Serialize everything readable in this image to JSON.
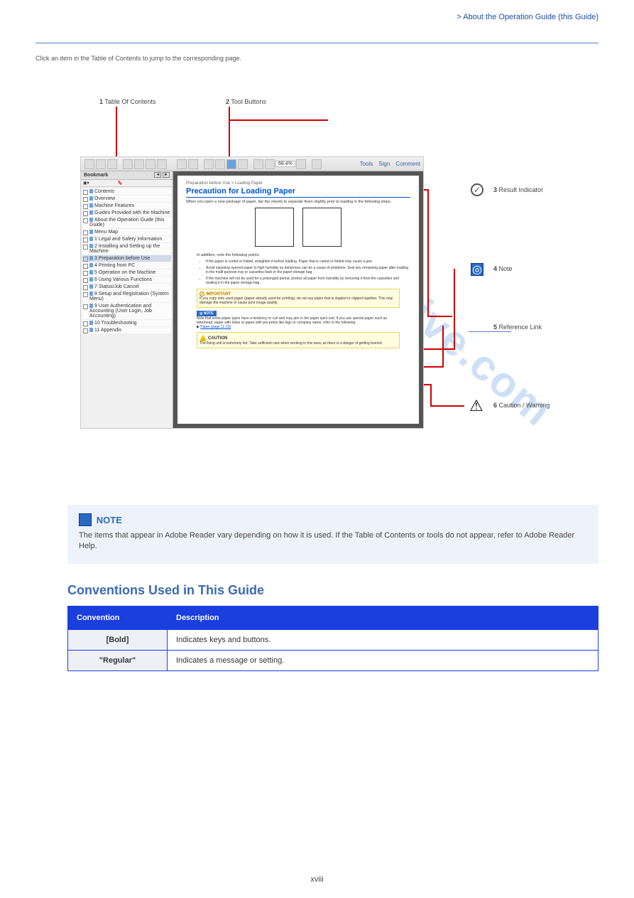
{
  "header": {
    "right": "> About the Operation Guide (this Guide)"
  },
  "intro": "Click an item in the Table of Contents to jump to the corresponding page.",
  "callouts": {
    "c1": {
      "num": "1",
      "text": "Table Of Contents"
    },
    "c2": {
      "num": "2",
      "text": "Tool Buttons"
    },
    "c3": {
      "num": "3",
      "text": "Result Indicator"
    },
    "c4": {
      "num": "4",
      "text": "Note"
    },
    "c5": {
      "num": "5",
      "text": "Reference Link"
    },
    "c6": {
      "num": "6",
      "text": "Caution / Warning"
    }
  },
  "screenshot": {
    "toolbar": {
      "zoom": "68.4%",
      "right": [
        "Tools",
        "Sign",
        "Comment"
      ]
    },
    "sidebar": {
      "tab": "Bookmark",
      "buttons": [
        "◄",
        "►"
      ],
      "items": [
        {
          "label": "Contents",
          "sel": false
        },
        {
          "label": "Overview",
          "sel": false
        },
        {
          "label": "Machine Features",
          "sel": false
        },
        {
          "label": "Guides Provided with the Machine",
          "sel": false
        },
        {
          "label": "About the Operation Guide (this Guide)",
          "sel": false
        },
        {
          "label": "Menu Map",
          "sel": false
        },
        {
          "label": "1 Legal and Safety Information",
          "sel": false
        },
        {
          "label": "2 Installing and Setting up the Machine",
          "sel": false
        },
        {
          "label": "3 Preparation before Use",
          "sel": true
        },
        {
          "label": "4 Printing from PC",
          "sel": false
        },
        {
          "label": "5 Operation on the Machine",
          "sel": false
        },
        {
          "label": "6 Using Various Functions",
          "sel": false
        },
        {
          "label": "7 Status/Job Cancel",
          "sel": false
        },
        {
          "label": "8 Setup and Registration (System Menu)",
          "sel": false
        },
        {
          "label": "9 User Authentication and Accounting (User Login, Job Accounting)",
          "sel": false
        },
        {
          "label": "10 Troubleshooting",
          "sel": false
        },
        {
          "label": "11 Appendix",
          "sel": false
        }
      ]
    },
    "doc": {
      "breadcrumb": "Preparation before Use > Loading Paper",
      "title": "Precaution for Loading Paper",
      "lead": "When you open a new package of paper, fan the sheets to separate them slightly prior to loading in the following steps.",
      "addition": "In addition, note the following points.",
      "bullets": [
        "If the paper is curled or folded, straighten it before loading. Paper that is curled or folded may cause a jam.",
        "Avoid exposing opened paper to high humidity as dampness can be a cause of problems. Seal any remaining paper after loading in the multi purpose tray or cassettes back in the paper storage bag.",
        "If the machine will not be used for a prolonged period, protect all paper from humidity by removing it from the cassettes and sealing it in the paper storage bag."
      ],
      "important": {
        "label": "IMPORTANT",
        "text": "If you copy onto used paper (paper already used for printing), do not use paper that is stapled or clipped together. This may damage the machine or cause poor image quality."
      },
      "note": {
        "label": "NOTE",
        "text": "Note that some paper types have a tendency to curl and may jam in the paper eject unit. If you use special paper such as letterhead, paper with holes or paper with pre-prints like logo or company name, refer to the following:",
        "link": "Paper (page 11-13)"
      },
      "caution": {
        "label": "CAUTION",
        "text": "The fixing unit is extremely hot. Take sufficient care when working in this area, as there is a danger of getting burned."
      }
    }
  },
  "big_note": {
    "label": "NOTE",
    "text": "The items that appear in Adobe Reader vary depending on how it is used. If the Table of Contents or tools do not appear, refer to Adobe Reader Help."
  },
  "conventions": {
    "heading": "Conventions Used in This Guide",
    "th1": "Convention",
    "th2": "Description",
    "rows": [
      {
        "c1": "[Bold]",
        "c2": "Indicates keys and buttons."
      },
      {
        "c1": "\"Regular\"",
        "c2": "Indicates a message or setting."
      }
    ]
  },
  "footer": "xviii"
}
